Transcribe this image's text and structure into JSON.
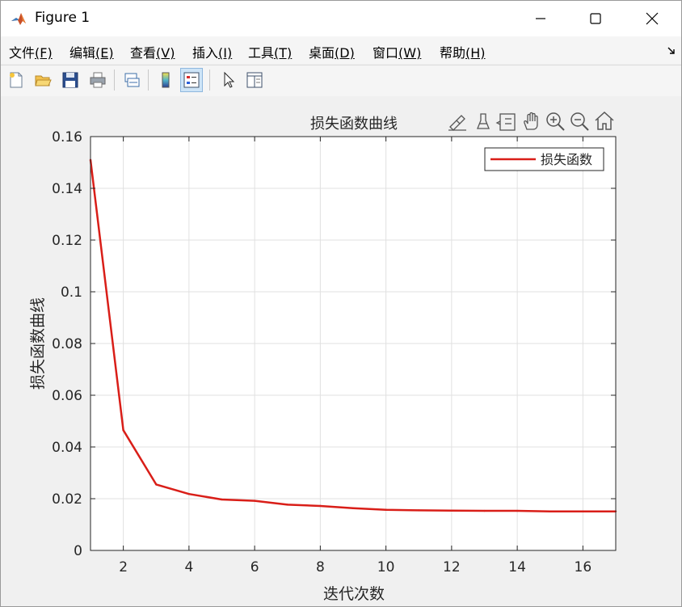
{
  "window": {
    "title": "Figure 1",
    "minimize_glyph": "minimize-icon",
    "maximize_glyph": "maximize-icon",
    "close_glyph": "close-icon"
  },
  "menu": [
    {
      "label": "文件",
      "accel": "(F)"
    },
    {
      "label": "编辑",
      "accel": "(E)"
    },
    {
      "label": "查看",
      "accel": "(V)"
    },
    {
      "label": "插入",
      "accel": "(I)"
    },
    {
      "label": "工具",
      "accel": "(T)"
    },
    {
      "label": "桌面",
      "accel": "(D)"
    },
    {
      "label": "窗口",
      "accel": "(W)"
    },
    {
      "label": "帮助",
      "accel": "(H)"
    }
  ],
  "toolbar": {
    "buttons": [
      "new-figure-icon",
      "open-file-icon",
      "save-icon",
      "print-icon",
      "link-plot-icon",
      "colorbar-icon",
      "legend-icon",
      "select-arrow-icon",
      "property-inspector-icon"
    ]
  },
  "axes_toolbar": {
    "buttons": [
      "brush-edit-icon",
      "data-brush-icon",
      "data-tips-icon",
      "pan-hand-icon",
      "zoom-in-icon",
      "zoom-out-icon",
      "home-icon"
    ]
  },
  "colors": {
    "line": "#d91e18",
    "grid": "#e0e0e0",
    "axis": "#262626"
  },
  "chart_data": {
    "type": "line",
    "title": "损失函数曲线",
    "xlabel": "迭代次数",
    "ylabel": "损失函数曲线",
    "xlim": [
      1,
      17
    ],
    "ylim": [
      0,
      0.16
    ],
    "xticks": [
      2,
      4,
      6,
      8,
      10,
      12,
      14,
      16
    ],
    "yticks": [
      0,
      0.02,
      0.04,
      0.06,
      0.08,
      0.1,
      0.12,
      0.14,
      0.16
    ],
    "ytick_labels": [
      "0",
      "0.02",
      "0.04",
      "0.06",
      "0.08",
      "0.1",
      "0.12",
      "0.14",
      "0.16"
    ],
    "grid": true,
    "legend_position": "top-right",
    "series": [
      {
        "name": "损失函数",
        "x": [
          1,
          2,
          3,
          4,
          5,
          6,
          7,
          8,
          9,
          10,
          11,
          12,
          13,
          14,
          15,
          16,
          17
        ],
        "values": [
          0.151,
          0.0465,
          0.0255,
          0.0218,
          0.0197,
          0.0192,
          0.0177,
          0.0172,
          0.0163,
          0.0157,
          0.0155,
          0.0154,
          0.0153,
          0.0153,
          0.0151,
          0.0151,
          0.0151
        ]
      }
    ]
  }
}
